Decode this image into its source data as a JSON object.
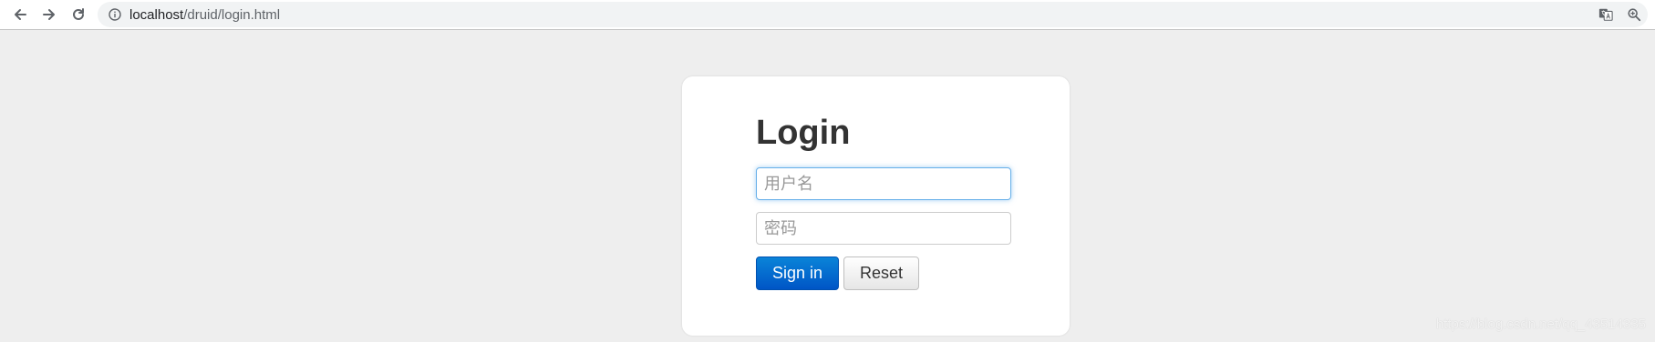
{
  "browser": {
    "url_host": "localhost",
    "url_path": "/druid/login.html",
    "back_icon": "arrow-left-icon",
    "forward_icon": "arrow-right-icon",
    "reload_icon": "reload-icon",
    "info_icon": "info-icon",
    "translate_icon": "translate-icon",
    "zoom_icon": "zoom-icon"
  },
  "login": {
    "title": "Login",
    "username_placeholder": "用户名",
    "password_placeholder": "密码",
    "signin_label": "Sign in",
    "reset_label": "Reset"
  },
  "watermark": "https://blog.csdn.net/qq_43514335",
  "colors": {
    "primary": "#0066cc",
    "focus": "#66afe9",
    "background": "#eeeeee"
  }
}
